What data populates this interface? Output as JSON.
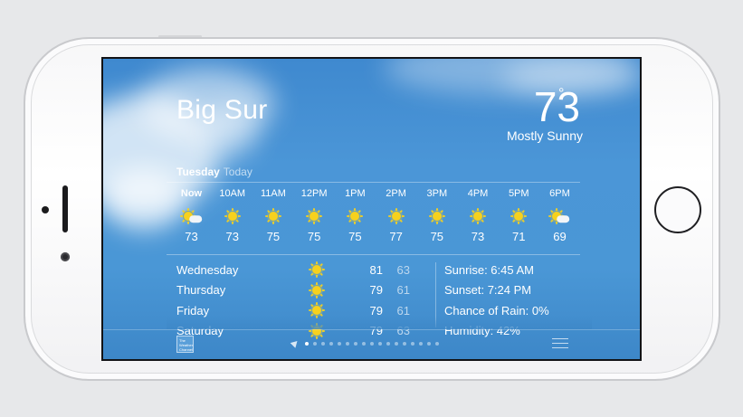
{
  "location": {
    "city": "Big Sur",
    "temperature": "73",
    "degree_symbol": "°",
    "condition": "Mostly Sunny"
  },
  "today": {
    "day": "Tuesday",
    "label": "Today"
  },
  "hourly": [
    {
      "time": "Now",
      "icon": "partly-cloudy-icon",
      "temp": "73"
    },
    {
      "time": "10AM",
      "icon": "sun-icon",
      "temp": "73"
    },
    {
      "time": "11AM",
      "icon": "sun-icon",
      "temp": "75"
    },
    {
      "time": "12PM",
      "icon": "sun-icon",
      "temp": "75"
    },
    {
      "time": "1PM",
      "icon": "sun-icon",
      "temp": "75"
    },
    {
      "time": "2PM",
      "icon": "sun-icon",
      "temp": "77"
    },
    {
      "time": "3PM",
      "icon": "sun-icon",
      "temp": "75"
    },
    {
      "time": "4PM",
      "icon": "sun-icon",
      "temp": "73"
    },
    {
      "time": "5PM",
      "icon": "sun-icon",
      "temp": "71"
    },
    {
      "time": "6PM",
      "icon": "partly-cloudy-icon",
      "temp": "69"
    }
  ],
  "daily": [
    {
      "day": "Wednesday",
      "icon": "sun-icon",
      "high": "81",
      "low": "63"
    },
    {
      "day": "Thursday",
      "icon": "sun-icon",
      "high": "79",
      "low": "61"
    },
    {
      "day": "Friday",
      "icon": "sun-icon",
      "high": "79",
      "low": "61"
    },
    {
      "day": "Saturday",
      "icon": "sun-icon",
      "high": "79",
      "low": "63"
    }
  ],
  "details": [
    {
      "text": "Sunrise: 6:45 AM"
    },
    {
      "text": "Sunset: 7:24 PM"
    },
    {
      "text": "Chance of Rain: 0%"
    },
    {
      "text": "Humidity: 42%"
    }
  ],
  "footer": {
    "twc_logo_text": "The Weather Channel",
    "page_count": 17,
    "active_page": 0
  },
  "colors": {
    "sky_blue": "#4a96d6",
    "sun_yellow": "#f7d11d"
  }
}
